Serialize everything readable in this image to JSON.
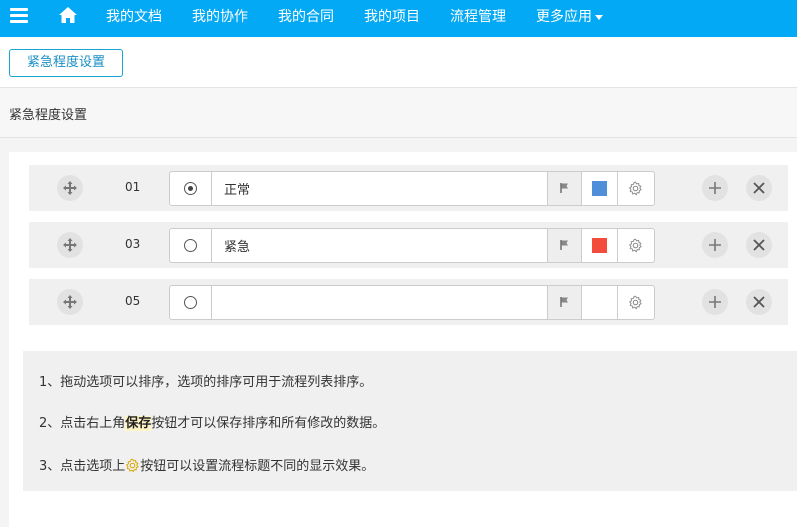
{
  "nav": {
    "menu_icon": "hamburger-icon",
    "home_icon": "home-icon",
    "items": [
      "我的文档",
      "我的协作",
      "我的合同",
      "我的项目",
      "流程管理",
      "更多应用"
    ]
  },
  "toolbar": {
    "button_label": "紧急程度设置"
  },
  "page": {
    "title": "紧急程度设置"
  },
  "options": [
    {
      "number": "01",
      "text": "正常",
      "selected": true,
      "color": "#4f8fda"
    },
    {
      "number": "03",
      "text": "紧急",
      "selected": false,
      "color": "#f44c3c"
    },
    {
      "number": "05",
      "text": "",
      "selected": false,
      "color": ""
    }
  ],
  "tips": {
    "line1": "1、拖动选项可以排序，选项的排序可用于流程列表排序。",
    "line2_prefix": "2、点击右上角",
    "line2_bold": "保存",
    "line2_suffix": "按钮才可以保存排序和所有修改的数据。",
    "line3_prefix": "3、点击选项上",
    "line3_suffix": "按钮可以设置流程标题不同的显示效果。"
  },
  "colors": {
    "nav_bg": "#03a9f4",
    "accent": "#1aa4d0"
  }
}
